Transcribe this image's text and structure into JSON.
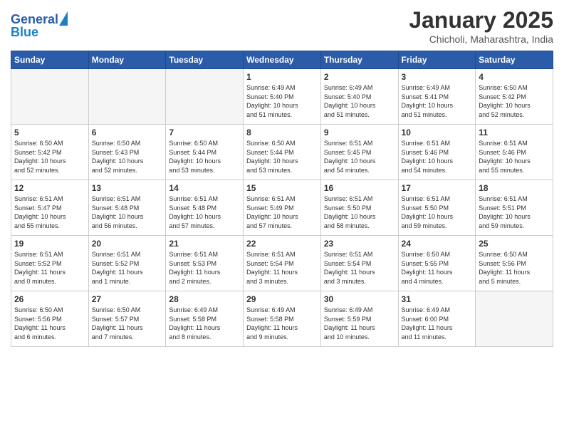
{
  "logo": {
    "line1": "General",
    "line2": "Blue"
  },
  "title": "January 2025",
  "subtitle": "Chicholi, Maharashtra, India",
  "headers": [
    "Sunday",
    "Monday",
    "Tuesday",
    "Wednesday",
    "Thursday",
    "Friday",
    "Saturday"
  ],
  "weeks": [
    [
      {
        "day": "",
        "info": ""
      },
      {
        "day": "",
        "info": ""
      },
      {
        "day": "",
        "info": ""
      },
      {
        "day": "1",
        "info": "Sunrise: 6:49 AM\nSunset: 5:40 PM\nDaylight: 10 hours\nand 51 minutes."
      },
      {
        "day": "2",
        "info": "Sunrise: 6:49 AM\nSunset: 5:40 PM\nDaylight: 10 hours\nand 51 minutes."
      },
      {
        "day": "3",
        "info": "Sunrise: 6:49 AM\nSunset: 5:41 PM\nDaylight: 10 hours\nand 51 minutes."
      },
      {
        "day": "4",
        "info": "Sunrise: 6:50 AM\nSunset: 5:42 PM\nDaylight: 10 hours\nand 52 minutes."
      }
    ],
    [
      {
        "day": "5",
        "info": "Sunrise: 6:50 AM\nSunset: 5:42 PM\nDaylight: 10 hours\nand 52 minutes."
      },
      {
        "day": "6",
        "info": "Sunrise: 6:50 AM\nSunset: 5:43 PM\nDaylight: 10 hours\nand 52 minutes."
      },
      {
        "day": "7",
        "info": "Sunrise: 6:50 AM\nSunset: 5:44 PM\nDaylight: 10 hours\nand 53 minutes."
      },
      {
        "day": "8",
        "info": "Sunrise: 6:50 AM\nSunset: 5:44 PM\nDaylight: 10 hours\nand 53 minutes."
      },
      {
        "day": "9",
        "info": "Sunrise: 6:51 AM\nSunset: 5:45 PM\nDaylight: 10 hours\nand 54 minutes."
      },
      {
        "day": "10",
        "info": "Sunrise: 6:51 AM\nSunset: 5:46 PM\nDaylight: 10 hours\nand 54 minutes."
      },
      {
        "day": "11",
        "info": "Sunrise: 6:51 AM\nSunset: 5:46 PM\nDaylight: 10 hours\nand 55 minutes."
      }
    ],
    [
      {
        "day": "12",
        "info": "Sunrise: 6:51 AM\nSunset: 5:47 PM\nDaylight: 10 hours\nand 55 minutes."
      },
      {
        "day": "13",
        "info": "Sunrise: 6:51 AM\nSunset: 5:48 PM\nDaylight: 10 hours\nand 56 minutes."
      },
      {
        "day": "14",
        "info": "Sunrise: 6:51 AM\nSunset: 5:48 PM\nDaylight: 10 hours\nand 57 minutes."
      },
      {
        "day": "15",
        "info": "Sunrise: 6:51 AM\nSunset: 5:49 PM\nDaylight: 10 hours\nand 57 minutes."
      },
      {
        "day": "16",
        "info": "Sunrise: 6:51 AM\nSunset: 5:50 PM\nDaylight: 10 hours\nand 58 minutes."
      },
      {
        "day": "17",
        "info": "Sunrise: 6:51 AM\nSunset: 5:50 PM\nDaylight: 10 hours\nand 59 minutes."
      },
      {
        "day": "18",
        "info": "Sunrise: 6:51 AM\nSunset: 5:51 PM\nDaylight: 10 hours\nand 59 minutes."
      }
    ],
    [
      {
        "day": "19",
        "info": "Sunrise: 6:51 AM\nSunset: 5:52 PM\nDaylight: 11 hours\nand 0 minutes."
      },
      {
        "day": "20",
        "info": "Sunrise: 6:51 AM\nSunset: 5:52 PM\nDaylight: 11 hours\nand 1 minute."
      },
      {
        "day": "21",
        "info": "Sunrise: 6:51 AM\nSunset: 5:53 PM\nDaylight: 11 hours\nand 2 minutes."
      },
      {
        "day": "22",
        "info": "Sunrise: 6:51 AM\nSunset: 5:54 PM\nDaylight: 11 hours\nand 3 minutes."
      },
      {
        "day": "23",
        "info": "Sunrise: 6:51 AM\nSunset: 5:54 PM\nDaylight: 11 hours\nand 3 minutes."
      },
      {
        "day": "24",
        "info": "Sunrise: 6:50 AM\nSunset: 5:55 PM\nDaylight: 11 hours\nand 4 minutes."
      },
      {
        "day": "25",
        "info": "Sunrise: 6:50 AM\nSunset: 5:56 PM\nDaylight: 11 hours\nand 5 minutes."
      }
    ],
    [
      {
        "day": "26",
        "info": "Sunrise: 6:50 AM\nSunset: 5:56 PM\nDaylight: 11 hours\nand 6 minutes."
      },
      {
        "day": "27",
        "info": "Sunrise: 6:50 AM\nSunset: 5:57 PM\nDaylight: 11 hours\nand 7 minutes."
      },
      {
        "day": "28",
        "info": "Sunrise: 6:49 AM\nSunset: 5:58 PM\nDaylight: 11 hours\nand 8 minutes."
      },
      {
        "day": "29",
        "info": "Sunrise: 6:49 AM\nSunset: 5:58 PM\nDaylight: 11 hours\nand 9 minutes."
      },
      {
        "day": "30",
        "info": "Sunrise: 6:49 AM\nSunset: 5:59 PM\nDaylight: 11 hours\nand 10 minutes."
      },
      {
        "day": "31",
        "info": "Sunrise: 6:49 AM\nSunset: 6:00 PM\nDaylight: 11 hours\nand 11 minutes."
      },
      {
        "day": "",
        "info": ""
      }
    ]
  ]
}
